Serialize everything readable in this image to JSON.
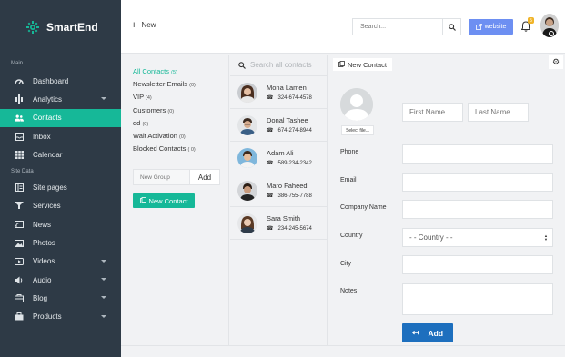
{
  "brand": {
    "name": "SmartEnd"
  },
  "sidebar": {
    "sections": [
      "Main",
      "Site Data"
    ],
    "main_items": [
      {
        "label": "Dashboard",
        "icon": "dashboard-icon"
      },
      {
        "label": "Analytics",
        "icon": "analytics-icon",
        "has_caret": true
      },
      {
        "label": "Contacts",
        "icon": "contacts-icon",
        "active": true
      },
      {
        "label": "Inbox",
        "icon": "inbox-icon"
      },
      {
        "label": "Calendar",
        "icon": "calendar-icon"
      }
    ],
    "site_items": [
      {
        "label": "Site pages",
        "icon": "pages-icon"
      },
      {
        "label": "Services",
        "icon": "services-icon"
      },
      {
        "label": "News",
        "icon": "news-icon"
      },
      {
        "label": "Photos",
        "icon": "photos-icon"
      },
      {
        "label": "Videos",
        "icon": "videos-icon",
        "has_caret": true
      },
      {
        "label": "Audio",
        "icon": "audio-icon",
        "has_caret": true
      },
      {
        "label": "Blog",
        "icon": "blog-icon",
        "has_caret": true
      },
      {
        "label": "Products",
        "icon": "products-icon",
        "has_caret": true
      }
    ]
  },
  "topbar": {
    "new_label": "New",
    "search_placeholder": "Search...",
    "website_label": "website",
    "notification_count": "5"
  },
  "groups": {
    "items": [
      {
        "name": "All Contacts",
        "count": "(5)",
        "active": true
      },
      {
        "name": "Newsletter Emails",
        "count": "(0)"
      },
      {
        "name": "VIP",
        "count": "(4)"
      },
      {
        "name": "Customers",
        "count": "(0)"
      },
      {
        "name": "dd",
        "count": "(0)"
      },
      {
        "name": "Wait Activation",
        "count": "(0)"
      },
      {
        "name": "Blocked Contacts",
        "count": "( 0)"
      }
    ],
    "new_group_placeholder": "New Group",
    "add_label": "Add",
    "new_contact_label": "New Contact"
  },
  "contacts": {
    "search_placeholder": "Search all contacts",
    "items": [
      {
        "name": "Mona Lamen",
        "phone": "324-674-4578"
      },
      {
        "name": "Donal Tashee",
        "phone": "674-274-8944"
      },
      {
        "name": "Adam Ali",
        "phone": "589-234-2342"
      },
      {
        "name": "Maro Faheed",
        "phone": "386-755-7788"
      },
      {
        "name": "Sara Smith",
        "phone": "234-245-5674"
      }
    ]
  },
  "form": {
    "tab_label": "New Contact",
    "select_file_label": "Select file...",
    "first_name_placeholder": "First Name",
    "last_name_placeholder": "Last Name",
    "labels": {
      "phone": "Phone",
      "email": "Email",
      "company": "Company Name",
      "country": "Country",
      "city": "City",
      "notes": "Notes"
    },
    "country_value": "- - Country - -",
    "add_label": "Add"
  },
  "colors": {
    "sidebar_bg": "#2e3a46",
    "accent": "#16b898",
    "primary_button": "#1d6fbe",
    "website_button": "#6d8ff2",
    "badge": "#f0b429"
  }
}
